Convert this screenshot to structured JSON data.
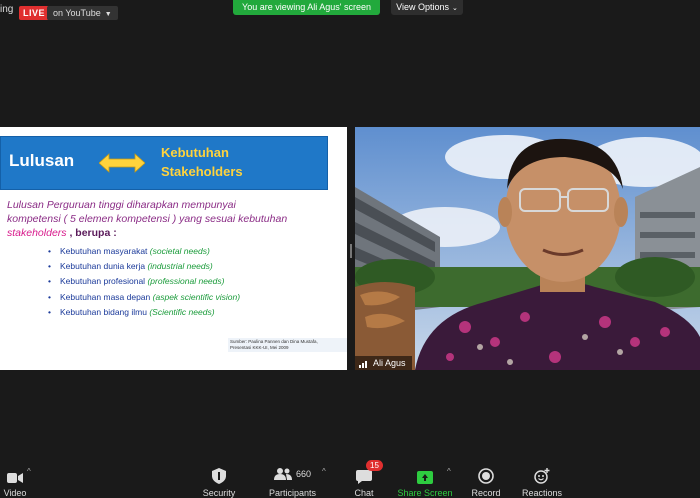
{
  "topbar": {
    "rec_text": "ing",
    "live_label": "LIVE",
    "stream_label": "on YouTube",
    "viewing_banner": "You are viewing Ali Agus' screen",
    "view_options": "View Options"
  },
  "slide": {
    "left_title": "Lulusan",
    "right_title_line1": "Kebutuhan",
    "right_title_line2": "Stakeholders",
    "intro_line1": "Lulusan Perguruan tinggi diharapkan mempunyai",
    "intro_line2": "kompetensi ( 5 elemen kompetensi ) yang sesuai kebutuhan",
    "intro_pink": "stakeholders",
    "intro_tail": " , berupa :",
    "items": [
      {
        "id": "Kebutuhan masyarakat",
        "en": "(societal needs)"
      },
      {
        "id": "Kebutuhan dunia kerja",
        "en": "(industrial needs)"
      },
      {
        "id": "Kebutuhan profesional",
        "en": "(professional needs)"
      },
      {
        "id": "Kebutuhan masa depan",
        "en": "(aspek scientific vision)"
      },
      {
        "id": "Kebutuhan bidang ilmu",
        "en": "(Scientific needs)"
      }
    ],
    "source_line1": "Sumber: Paulina Pannen dan Dina Mustafa,",
    "source_line2": "Presentasi KKK-UI, Mei 2009"
  },
  "participant": {
    "name": "Ali Agus"
  },
  "toolbar": {
    "video": "Video",
    "security": "Security",
    "participants": "Participants",
    "participants_count": "660",
    "chat": "Chat",
    "chat_badge": "15",
    "share_screen": "Share Screen",
    "record": "Record",
    "reactions": "Reactions"
  },
  "colors": {
    "live": "#e02f2f",
    "banner": "#22a93c",
    "slide_bar": "#1f78c8",
    "slide_accent": "#ffd33d"
  }
}
